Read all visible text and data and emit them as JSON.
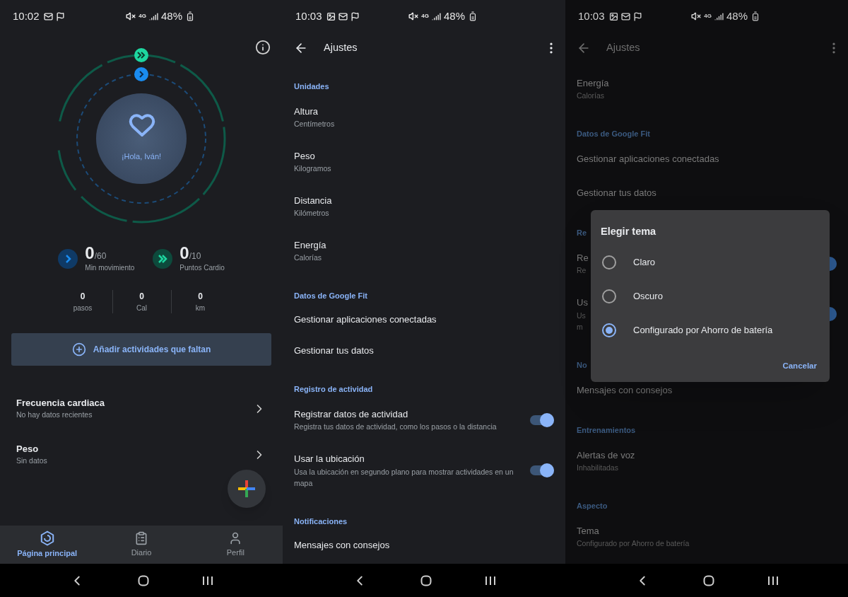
{
  "screens": [
    {
      "kind": "home",
      "status_bar": {
        "time": "10:02",
        "notification_icons": [
          {
            "kind": "mail"
          },
          {
            "kind": "flag"
          }
        ],
        "network": "4G",
        "battery": "48%"
      },
      "greeting": "¡Hola, Iván!",
      "goals": [
        {
          "kind": "move",
          "value": "0",
          "target": "/60",
          "label": "Min movimiento"
        },
        {
          "kind": "cardio",
          "value": "0",
          "target": "/10",
          "label": "Puntos Cardio"
        }
      ],
      "stats": [
        {
          "value": "0",
          "label": "pasos"
        },
        {
          "value": "0",
          "label": "Cal"
        },
        {
          "value": "0",
          "label": "km"
        }
      ],
      "add_button": "Añadir actividades que faltan",
      "cards": [
        {
          "title": "Frecuencia cardiaca",
          "subtitle": "No hay datos recientes"
        },
        {
          "title": "Peso",
          "subtitle": "Sin datos"
        }
      ],
      "bottom_nav": [
        {
          "kind": "home",
          "label": "Página principal",
          "selected": true
        },
        {
          "kind": "journal",
          "label": "Diario",
          "selected": false
        },
        {
          "kind": "profile",
          "label": "Perfil",
          "selected": false
        }
      ]
    },
    {
      "kind": "settings",
      "status_bar": {
        "time": "10:03",
        "notification_icons": [
          {
            "kind": "image"
          },
          {
            "kind": "mail"
          },
          {
            "kind": "flag"
          }
        ],
        "network": "4G",
        "battery": "48%"
      },
      "title": "Ajustes",
      "rows": [
        {
          "kind": "header",
          "title": "Unidades"
        },
        {
          "kind": "item",
          "title": "Altura",
          "subtitle": "Centímetros"
        },
        {
          "kind": "item",
          "title": "Peso",
          "subtitle": "Kilogramos"
        },
        {
          "kind": "item",
          "title": "Distancia",
          "subtitle": "Kilómetros"
        },
        {
          "kind": "item",
          "title": "Energía",
          "subtitle": "Calorías"
        },
        {
          "kind": "header",
          "title": "Datos de Google Fit"
        },
        {
          "kind": "item",
          "title": "Gestionar aplicaciones conectadas"
        },
        {
          "kind": "item",
          "title": "Gestionar tus datos"
        },
        {
          "kind": "header",
          "title": "Registro de actividad"
        },
        {
          "kind": "item",
          "title": "Registrar datos de actividad",
          "subtitle": "Registra tus datos de actividad, como los pasos o la distancia",
          "toggle": {
            "on": true
          }
        },
        {
          "kind": "item",
          "title": "Usar la ubicación",
          "subtitle": "Usa la ubicación en segundo plano para mostrar actividades en un mapa",
          "toggle": {
            "on": true
          }
        },
        {
          "kind": "header",
          "title": "Notificaciones"
        },
        {
          "kind": "item",
          "title": "Mensajes con consejos"
        }
      ]
    },
    {
      "kind": "settings_dialog",
      "status_bar": {
        "time": "10:03",
        "notification_icons": [
          {
            "kind": "image"
          },
          {
            "kind": "mail"
          },
          {
            "kind": "flag"
          }
        ],
        "network": "4G",
        "battery": "48%"
      },
      "title": "Ajustes",
      "rows": [
        {
          "kind": "item",
          "title": "Energía",
          "subtitle": "Calorías"
        },
        {
          "kind": "header",
          "title": "Datos de Google Fit"
        },
        {
          "kind": "item",
          "title": "Gestionar aplicaciones conectadas"
        },
        {
          "kind": "item",
          "title": "Gestionar tus datos"
        },
        {
          "kind": "header",
          "title": "Re"
        },
        {
          "kind": "item",
          "title": "Re",
          "subtitle": "Re",
          "toggle": {
            "on": true
          }
        },
        {
          "kind": "item",
          "title": "Us",
          "subtitle": "Us",
          "subtitle_2": "m",
          "toggle": {
            "on": true
          }
        },
        {
          "kind": "header",
          "title": "No"
        },
        {
          "kind": "item",
          "title": "Mensajes con consejos"
        },
        {
          "kind": "header",
          "title": "Entrenamientos"
        },
        {
          "kind": "item",
          "title": "Alertas de voz",
          "subtitle": "Inhabilitadas"
        },
        {
          "kind": "header",
          "title": "Aspecto"
        },
        {
          "kind": "item",
          "title": "Tema",
          "subtitle": "Configurado por Ahorro de batería"
        }
      ],
      "dialog": {
        "title": "Elegir tema",
        "options": [
          {
            "label": "Claro",
            "selected": false
          },
          {
            "label": "Oscuro",
            "selected": false
          },
          {
            "label": "Configurado por Ahorro de batería",
            "selected": true
          }
        ],
        "button": "Cancelar"
      }
    }
  ]
}
